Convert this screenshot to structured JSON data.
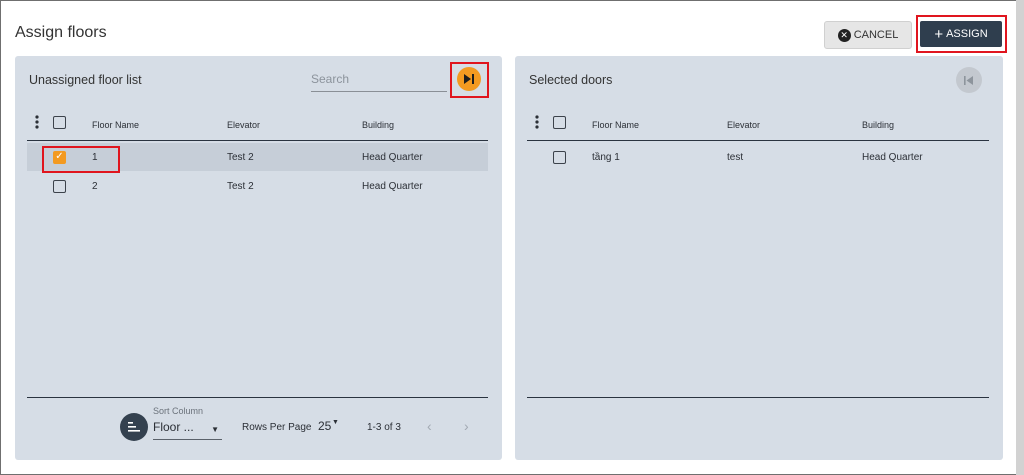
{
  "dialog": {
    "title": "Assign floors"
  },
  "actions": {
    "cancel_label": "CANCEL",
    "assign_label": "ASSIGN"
  },
  "left_panel": {
    "title": "Unassigned floor list",
    "search_placeholder": "Search",
    "columns": [
      "Floor Name",
      "Elevator",
      "Building"
    ],
    "rows": [
      {
        "floor": "1",
        "elevator": "Test 2",
        "building": "Head Quarter",
        "checked": true
      },
      {
        "floor": "2",
        "elevator": "Test 2",
        "building": "Head Quarter",
        "checked": false
      }
    ],
    "footer": {
      "sort_label": "Sort Column",
      "sort_value": "Floor ...",
      "rows_per_page_label": "Rows Per Page",
      "rows_per_page_value": "25",
      "page_info": "1-3 of 3"
    }
  },
  "right_panel": {
    "title": "Selected doors",
    "columns": [
      "Floor Name",
      "Elevator",
      "Building"
    ],
    "rows": [
      {
        "floor": "tầng 1",
        "elevator": "test",
        "building": "Head Quarter",
        "checked": false
      }
    ]
  },
  "colors": {
    "accent": "#f39a21",
    "primary": "#2f3e4e",
    "panel_bg": "#d6dde6",
    "highlight": "#e0151e"
  }
}
